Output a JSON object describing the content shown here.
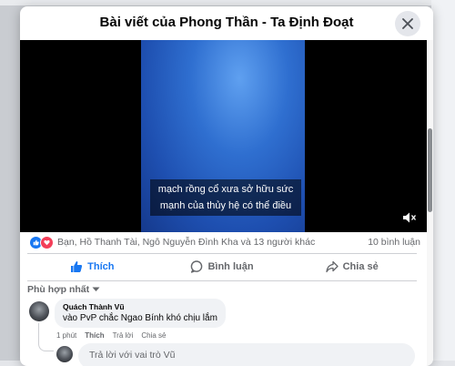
{
  "dialog": {
    "title": "Bài viết của Phong Thần - Ta Định Đoạt"
  },
  "video": {
    "subtitle": "mạch rồng cổ xưa sở hữu sức mạnh của thủy hệ có thể điều"
  },
  "reactions": {
    "summary": "Bạn, Hồ Thanh Tài, Ngô Nguyễn Đình Kha và 13 người khác",
    "comment_count": "10 bình luận"
  },
  "actions": {
    "like": "Thích",
    "comment": "Bình luận",
    "share": "Chia sẻ"
  },
  "sort": {
    "label": "Phù hợp nhất"
  },
  "comment": {
    "author": "Quách Thành Vũ",
    "text": "vào PvP chắc Ngao Bính khó chịu lắm",
    "time": "1 phút",
    "like": "Thích",
    "reply": "Trả lời",
    "share": "Chia sẻ"
  },
  "reply_box": {
    "placeholder": "Trả lời với vai trò Vũ"
  },
  "colors": {
    "accent": "#1877f2",
    "love": "#f33e58",
    "muted_text": "#65676b"
  }
}
